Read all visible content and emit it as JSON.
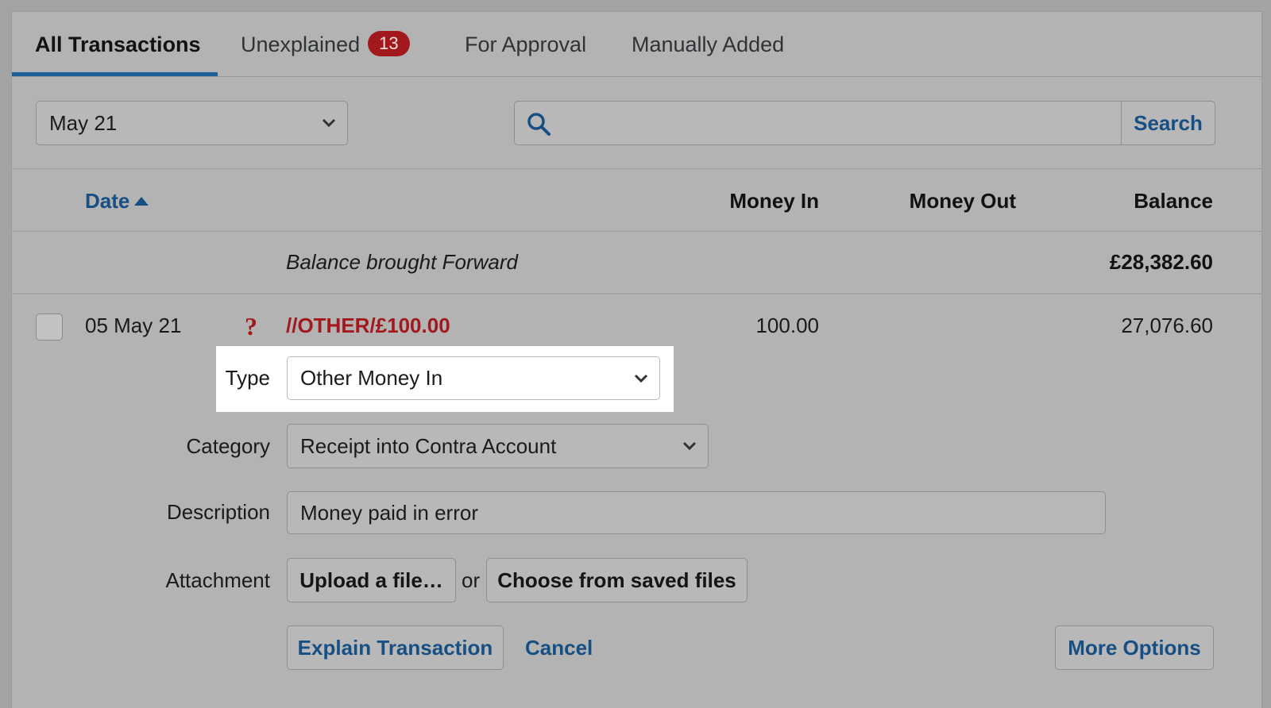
{
  "tabs": {
    "all": "All Transactions",
    "unexplained": "Unexplained",
    "unexplained_count": "13",
    "approval": "For Approval",
    "manual": "Manually Added"
  },
  "filter": {
    "period": "May 21",
    "search_button": "Search",
    "search_value": ""
  },
  "columns": {
    "date": "Date",
    "money_in": "Money In",
    "money_out": "Money Out",
    "balance": "Balance"
  },
  "balance_forward": {
    "label": "Balance brought Forward",
    "amount": "£28,382.60"
  },
  "transaction": {
    "date": "05 May 21",
    "status_symbol": "?",
    "description": "//OTHER/£100.00",
    "money_in": "100.00",
    "balance": "27,076.60"
  },
  "form": {
    "type_label": "Type",
    "type_value": "Other Money In",
    "category_label": "Category",
    "category_value": "Receipt into Contra Account",
    "description_label": "Description",
    "description_value": "Money paid in error",
    "attachment_label": "Attachment",
    "upload_button": "Upload a file…",
    "or_text": "or",
    "choose_button": "Choose from saved files",
    "explain_button": "Explain Transaction",
    "cancel_link": "Cancel",
    "more_button": "More Options"
  },
  "colors": {
    "accent": "#174f84",
    "alert": "#a3181c",
    "background": "#b3b3b3"
  }
}
